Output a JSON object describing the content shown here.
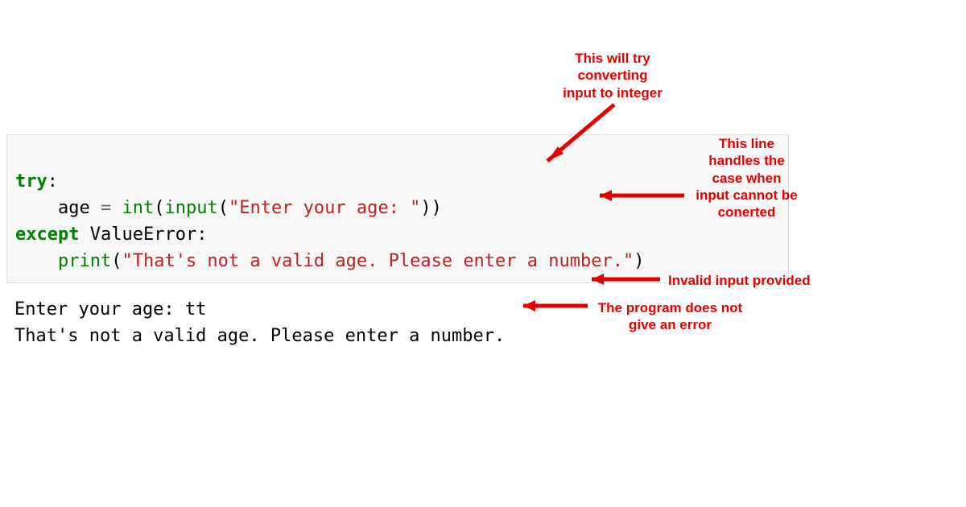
{
  "code": {
    "line1": {
      "try": "try",
      "colon": ":"
    },
    "line2": {
      "indent": "    ",
      "age": "age",
      "eq": " = ",
      "int": "int",
      "lp1": "(",
      "input": "input",
      "lp2": "(",
      "str": "\"Enter your age: \"",
      "rp2": ")",
      "rp1": ")"
    },
    "line3": {
      "except": "except",
      "space": " ",
      "err": "ValueError",
      "colon": ":"
    },
    "line4": {
      "indent": "    ",
      "print": "print",
      "lp": "(",
      "str": "\"That's not a valid age. Please enter a number.\"",
      "rp": ")"
    }
  },
  "output": {
    "line1": "Enter your age: tt",
    "line2": "That's not a valid age. Please enter a number."
  },
  "annotations": {
    "try_convert": "This will try\nconverting\ninput to integer",
    "handles": "This line\nhandles the\ncase when\ninput cannot be\nconerted",
    "invalid_input": "Invalid input provided",
    "no_error": "The program does not\ngive an error"
  },
  "colors": {
    "annotation": "#e60000"
  }
}
